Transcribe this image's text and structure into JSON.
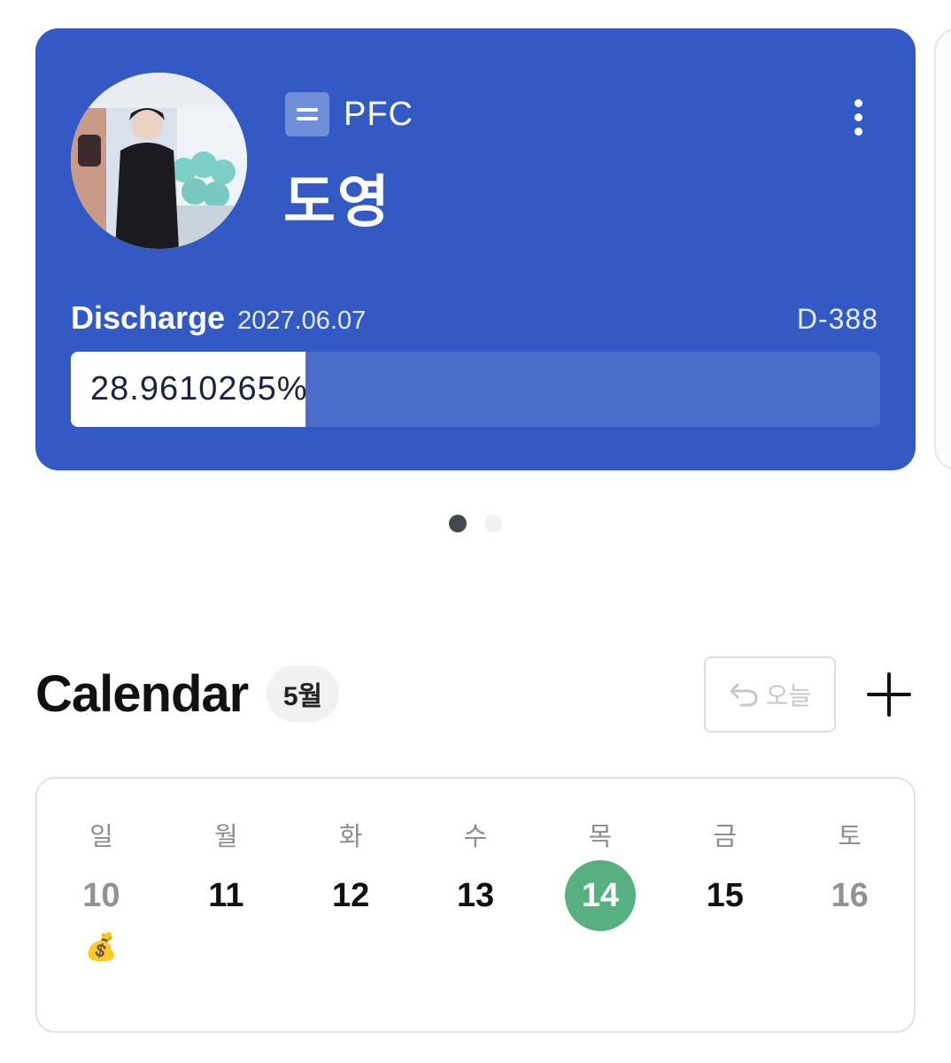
{
  "profile_card": {
    "unit": "PFC",
    "name": "도영",
    "discharge_label": "Discharge",
    "discharge_date": "2027.06.07",
    "d_day": "D-388",
    "progress_text": "28.9610265%",
    "progress_fraction": 0.289610265,
    "card_color": "#3259c4"
  },
  "pager": {
    "count": 2,
    "active_index": 0
  },
  "calendar": {
    "title": "Calendar",
    "month": "5월",
    "today_label": "오늘",
    "add_icon": "plus-icon",
    "today_icon": "undo-arrow-icon",
    "today_color": "#56b07f",
    "days": [
      {
        "weekday": "일",
        "date": "10",
        "weekend": true,
        "event": "💰"
      },
      {
        "weekday": "월",
        "date": "11"
      },
      {
        "weekday": "화",
        "date": "12"
      },
      {
        "weekday": "수",
        "date": "13"
      },
      {
        "weekday": "목",
        "date": "14",
        "today": true
      },
      {
        "weekday": "금",
        "date": "15"
      },
      {
        "weekday": "토",
        "date": "16",
        "weekend": true
      }
    ]
  }
}
